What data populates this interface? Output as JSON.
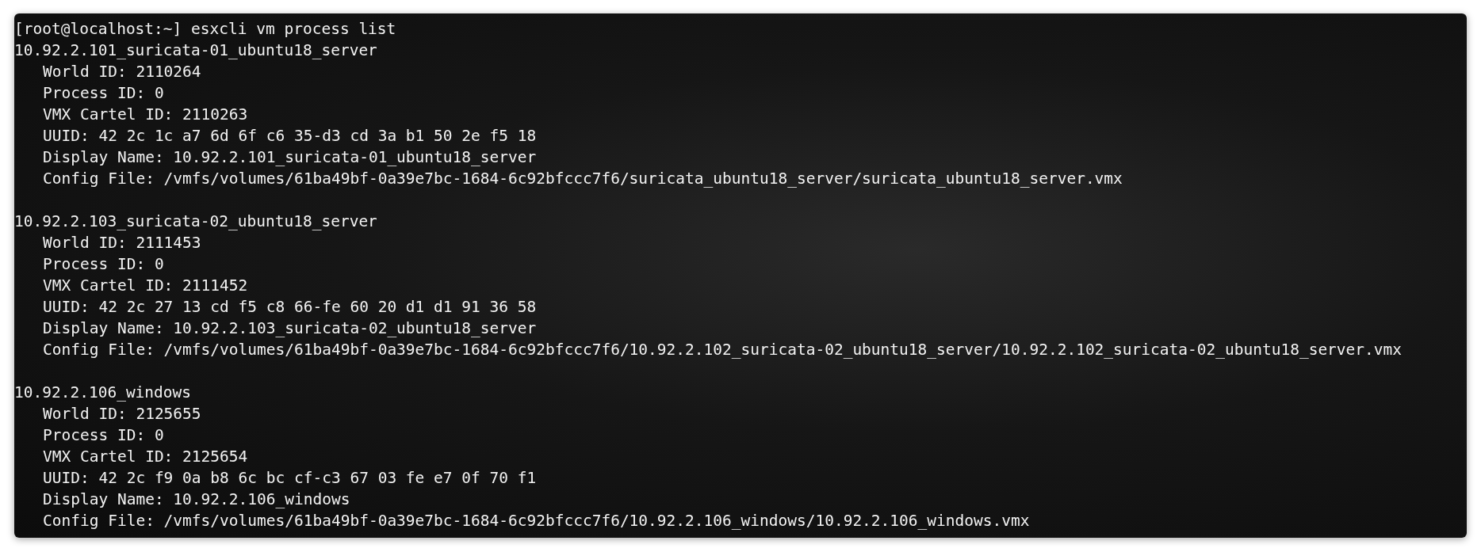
{
  "terminal": {
    "command_line": "[root@localhost:~] esxcli vm process list",
    "processes": [
      {
        "name": "10.92.2.101_suricata-01_ubuntu18_server",
        "fields": [
          "World ID: 2110264",
          "Process ID: 0",
          "VMX Cartel ID: 2110263",
          "UUID: 42 2c 1c a7 6d 6f c6 35-d3 cd 3a b1 50 2e f5 18",
          "Display Name: 10.92.2.101_suricata-01_ubuntu18_server",
          "Config File: /vmfs/volumes/61ba49bf-0a39e7bc-1684-6c92bfccc7f6/suricata_ubuntu18_server/suricata_ubuntu18_server.vmx"
        ]
      },
      {
        "name": "10.92.2.103_suricata-02_ubuntu18_server",
        "fields": [
          "World ID: 2111453",
          "Process ID: 0",
          "VMX Cartel ID: 2111452",
          "UUID: 42 2c 27 13 cd f5 c8 66-fe 60 20 d1 d1 91 36 58",
          "Display Name: 10.92.2.103_suricata-02_ubuntu18_server",
          "Config File: /vmfs/volumes/61ba49bf-0a39e7bc-1684-6c92bfccc7f6/10.92.2.102_suricata-02_ubuntu18_server/10.92.2.102_suricata-02_ubuntu18_server.vmx"
        ]
      },
      {
        "name": "10.92.2.106_windows",
        "fields": [
          "World ID: 2125655",
          "Process ID: 0",
          "VMX Cartel ID: 2125654",
          "UUID: 42 2c f9 0a b8 6c bc cf-c3 67 03 fe e7 0f 70 f1",
          "Display Name: 10.92.2.106_windows",
          "Config File: /vmfs/volumes/61ba49bf-0a39e7bc-1684-6c92bfccc7f6/10.92.2.106_windows/10.92.2.106_windows.vmx"
        ]
      }
    ]
  }
}
